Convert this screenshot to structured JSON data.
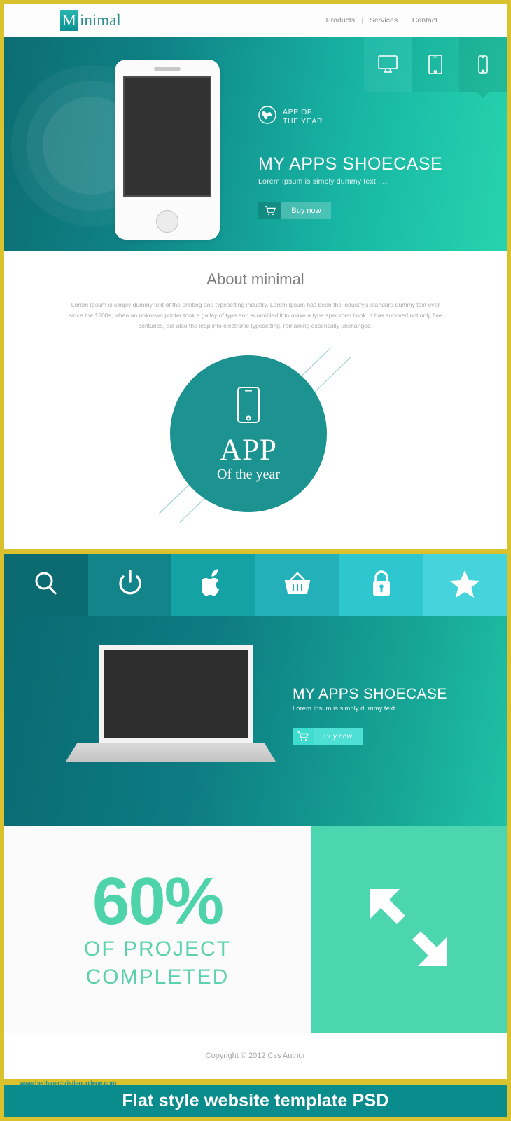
{
  "theme": {
    "page_border": "#d9c22e",
    "teal_dark": "#0c6d72",
    "teal_bright": "#27d4ae",
    "mint": "#4bd6af",
    "badge_teal": "#1d9391",
    "psd_bar": "#0b8c8c"
  },
  "header": {
    "logo_badge_letter": "M",
    "logo_word": "inimal",
    "nav": [
      {
        "label": "Products"
      },
      {
        "label": "Services"
      },
      {
        "label": "Contact"
      }
    ],
    "nav_separator": "|"
  },
  "hero": {
    "device_tabs": [
      {
        "icon": "desktop-monitor-icon",
        "label": "Desktop"
      },
      {
        "icon": "tablet-icon",
        "label": "Tablet"
      },
      {
        "icon": "mobile-phone-icon",
        "label": "Mobile"
      }
    ],
    "award_icon": "globe-icon",
    "award_line1": "APP OF",
    "award_line2": "THE YEAR",
    "title": "MY APPS SHOECASE",
    "subtitle": "Lorem Ipsum is simply dummy text .....",
    "buy_icon": "shopping-cart-icon",
    "buy_label": "Buy now"
  },
  "about": {
    "title": "About minimal",
    "body": "Lorem Ipsum is simply dummy text of the printing and typesetting industry. Lorem Ipsum has been the industry's standard dummy text ever since the 1500s, when an unknown printer took a galley of type and scrambled it to make a type specimen book. It has survived not only five centuries, but also the leap into electronic typesetting, remaining essentially unchanged.",
    "badge": {
      "icon": "mobile-phone-icon",
      "line1": "APP",
      "line2": "Of the year"
    }
  },
  "icon_strip": [
    {
      "name": "search-icon",
      "bg": "#0c6b70"
    },
    {
      "name": "power-icon",
      "bg": "#13848a"
    },
    {
      "name": "apple-icon",
      "bg": "#15a2a4"
    },
    {
      "name": "basket-icon",
      "bg": "#23b0b8"
    },
    {
      "name": "lock-icon",
      "bg": "#2ec6cf"
    },
    {
      "name": "star-icon",
      "bg": "#45d3dc"
    }
  ],
  "laptop_section": {
    "device_icon": "laptop-icon",
    "title": "MY APPS SHOECASE",
    "subtitle": "Lorem Ipsum is simply dummy text .....",
    "buy_icon": "shopping-cart-icon",
    "buy_label": "Buy now"
  },
  "stats": {
    "percent": "60%",
    "line1": "OF PROJECT",
    "line2": "COMPLETED",
    "arrows_icon": "expand-arrows-icon"
  },
  "footer": {
    "copyright": "Copyright © 2012 Css Author",
    "watermark": "www.heritagechristiancollege.com",
    "psd_banner": "Flat style  website template PSD"
  }
}
